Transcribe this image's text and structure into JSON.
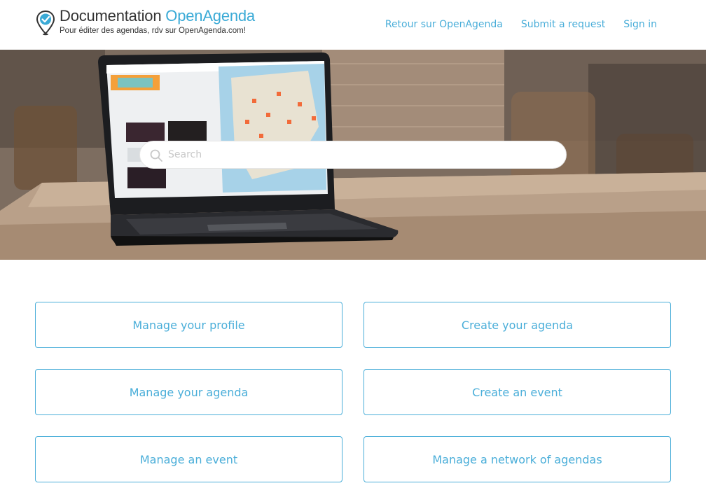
{
  "header": {
    "logo": {
      "title_main": "Documentation ",
      "title_brand": "OpenAgenda",
      "tagline": "Pour éditer des agendas, rdv sur OpenAgenda.com!"
    },
    "nav": [
      {
        "label": "Retour sur OpenAgenda"
      },
      {
        "label": "Submit a request"
      },
      {
        "label": "Sign in"
      }
    ]
  },
  "search": {
    "placeholder": "Search",
    "value": "",
    "icon": "search-icon"
  },
  "categories": [
    {
      "label": "Manage your profile"
    },
    {
      "label": "Create your agenda"
    },
    {
      "label": "Manage your agenda"
    },
    {
      "label": "Create an event"
    },
    {
      "label": "Manage an event"
    },
    {
      "label": "Manage a network of agendas"
    }
  ],
  "colors": {
    "accent": "#4aaed9",
    "text": "#333333",
    "block_border": "#4aaed9"
  }
}
